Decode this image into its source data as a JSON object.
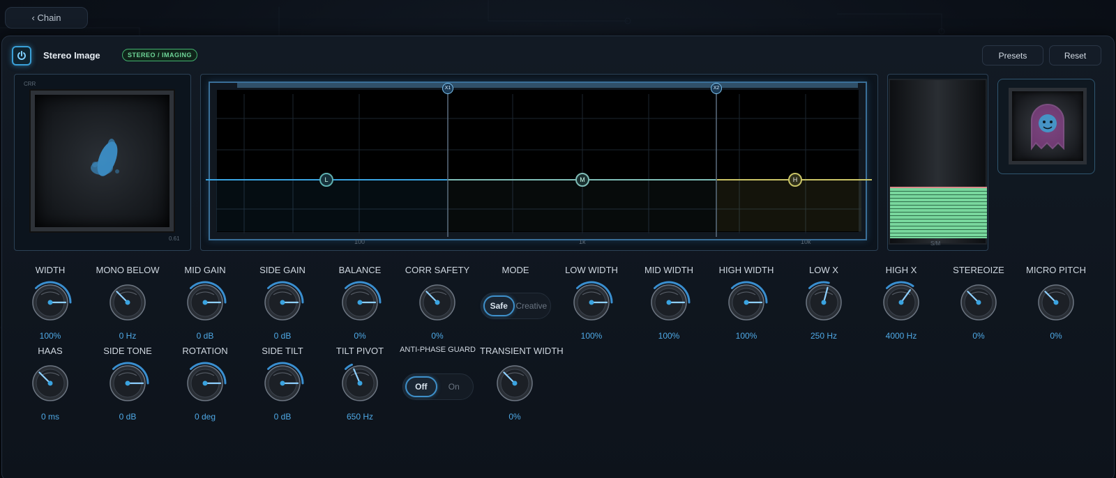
{
  "nav": {
    "back_label": "‹ Chain"
  },
  "header": {
    "title": "Stereo Image",
    "tag": "STEREO / IMAGING",
    "presets_label": "Presets",
    "reset_label": "Reset"
  },
  "vectorscope": {
    "corner_tl": "CRR",
    "corner_br": "0.61"
  },
  "crossover": {
    "handle_x1": "X1",
    "handle_x2": "X2",
    "band_low": "L",
    "band_mid": "M",
    "band_high": "H",
    "freq_labels": [
      "100",
      "1k",
      "10k"
    ],
    "colors": {
      "low": "#3aa3e0",
      "mid": "#7fbcb6",
      "high": "#c9c467"
    }
  },
  "meter": {
    "label": "S/M",
    "level": 0.3
  },
  "knobs_row1": [
    {
      "name": "width-knob",
      "label": "WIDTH",
      "value": "100%",
      "pos": 0.5
    },
    {
      "name": "mono-below-knob",
      "label": "MONO BELOW",
      "value": "0 Hz",
      "pos": 0.0
    },
    {
      "name": "mid-gain-knob",
      "label": "MID GAIN",
      "value": "0 dB",
      "pos": 0.5
    },
    {
      "name": "side-gain-knob",
      "label": "SIDE GAIN",
      "value": "0 dB",
      "pos": 0.5
    },
    {
      "name": "balance-knob",
      "label": "BALANCE",
      "value": "0%",
      "pos": 0.5
    },
    {
      "name": "corr-safety-knob",
      "label": "CORR SAFETY",
      "value": "0%",
      "pos": 0.0
    },
    {
      "name": "low-width-knob",
      "label": "LOW WIDTH",
      "value": "100%",
      "pos": 0.5
    },
    {
      "name": "mid-width-knob",
      "label": "MID WIDTH",
      "value": "100%",
      "pos": 0.5
    },
    {
      "name": "high-width-knob",
      "label": "HIGH WIDTH",
      "value": "100%",
      "pos": 0.5
    },
    {
      "name": "low-x-knob",
      "label": "LOW X",
      "value": "250 Hz",
      "pos": 0.22
    },
    {
      "name": "high-x-knob",
      "label": "HIGH X",
      "value": "4000 Hz",
      "pos": 0.3
    },
    {
      "name": "stereoize-knob",
      "label": "STEREOIZE",
      "value": "0%",
      "pos": 0.0
    },
    {
      "name": "micro-pitch-knob",
      "label": "MICRO PITCH",
      "value": "0%",
      "pos": 0.0
    }
  ],
  "knobs_row2": [
    {
      "name": "haas-knob",
      "label": "HAAS",
      "value": "0 ms",
      "pos": 0.0
    },
    {
      "name": "side-tone-knob",
      "label": "SIDE TONE",
      "value": "0 dB",
      "pos": 0.5
    },
    {
      "name": "rotation-knob",
      "label": "ROTATION",
      "value": "0 deg",
      "pos": 0.5
    },
    {
      "name": "side-tilt-knob",
      "label": "SIDE TILT",
      "value": "0 dB",
      "pos": 0.5
    },
    {
      "name": "tilt-pivot-knob",
      "label": "TILT PIVOT",
      "value": "650 Hz",
      "pos": 0.08
    },
    {
      "name": "transient-width-knob",
      "label": "TRANSIENT WIDTH",
      "value": "0%",
      "pos": 0.0
    }
  ],
  "mode": {
    "label": "MODE",
    "options": [
      "Safe",
      "Creative"
    ],
    "selected": "Safe"
  },
  "anti_phase": {
    "label": "ANTI-PHASE GUARD",
    "options": [
      "Off",
      "On"
    ],
    "selected": "Off"
  },
  "colors": {
    "accent": "#3aa3e0",
    "value_text": "#4fa9e6",
    "tag_green": "#6fd699"
  }
}
